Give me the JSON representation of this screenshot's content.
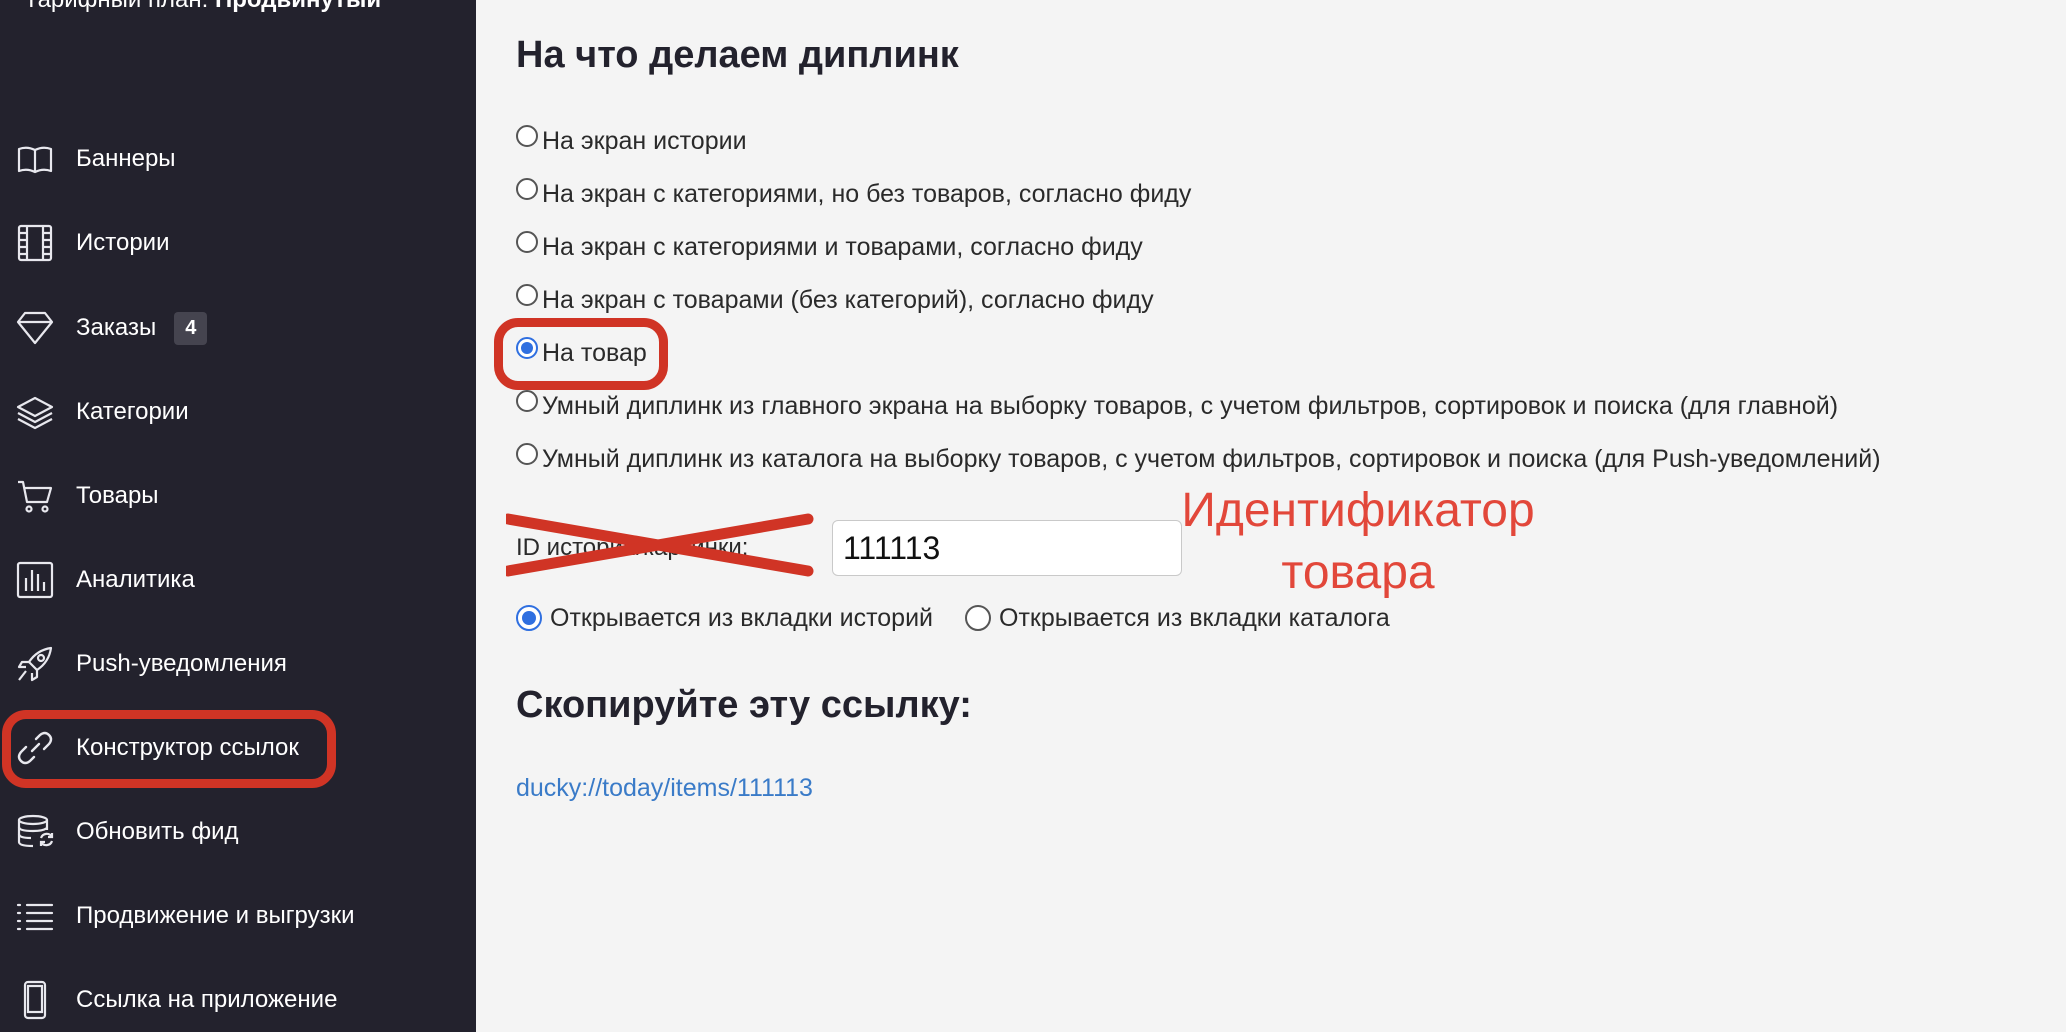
{
  "sidebar": {
    "tariff_prefix": "Тарифный план:",
    "tariff_name": "Продвинутый",
    "items": [
      {
        "label": "Баннеры",
        "icon": "book-icon"
      },
      {
        "label": "Истории",
        "icon": "film-icon"
      },
      {
        "label": "Заказы",
        "icon": "diamond-icon",
        "badge": "4"
      },
      {
        "label": "Категории",
        "icon": "layers-icon"
      },
      {
        "label": "Товары",
        "icon": "cart-icon"
      },
      {
        "label": "Аналитика",
        "icon": "bar-chart-icon"
      },
      {
        "label": "Push-уведомления",
        "icon": "rocket-icon"
      },
      {
        "label": "Конструктор ссылок",
        "icon": "link-icon",
        "active": true
      },
      {
        "label": "Обновить фид",
        "icon": "database-refresh-icon"
      },
      {
        "label": "Продвижение и выгрузки",
        "icon": "list-icon"
      },
      {
        "label": "Ссылка на приложение",
        "icon": "phone-icon"
      }
    ]
  },
  "main": {
    "title": "На что делаем диплинк",
    "options": [
      {
        "label": "На экран истории",
        "checked": false
      },
      {
        "label": "На экран с категориями, но без товаров, согласно фиду",
        "checked": false
      },
      {
        "label": "На экран с категориями и товарами, согласно фиду",
        "checked": false
      },
      {
        "label": "На экран с товарами (без категорий), согласно фиду",
        "checked": false
      },
      {
        "label": "На товар",
        "checked": true
      },
      {
        "label": "Умный диплинк из главного экрана на выборку товаров, с учетом фильтров, сортировок и поиска (для главной)",
        "checked": false
      },
      {
        "label": "Умный диплинк из каталога на выборку товаров, с учетом фильтров, сортировок и поиска (для Push-уведомлений)",
        "checked": false
      }
    ],
    "id_label": "ID истории/картинки:",
    "id_value": "111113",
    "annotation_line1": "Идентификатор",
    "annotation_line2": "товара",
    "tab_options": [
      {
        "label": "Открывается из вкладки историй",
        "checked": true
      },
      {
        "label": "Открывается из вкладки каталога",
        "checked": false
      }
    ],
    "copy_title": "Скопируйте эту ссылку:",
    "link": "ducky://today/items/111113"
  },
  "colors": {
    "sidebar_bg": "#23222d",
    "content_bg": "#f4f4f4",
    "highlight": "#d03425",
    "annotation": "#e2473a",
    "link": "#3a7bc8",
    "radio_checked": "#2f6fe0"
  }
}
